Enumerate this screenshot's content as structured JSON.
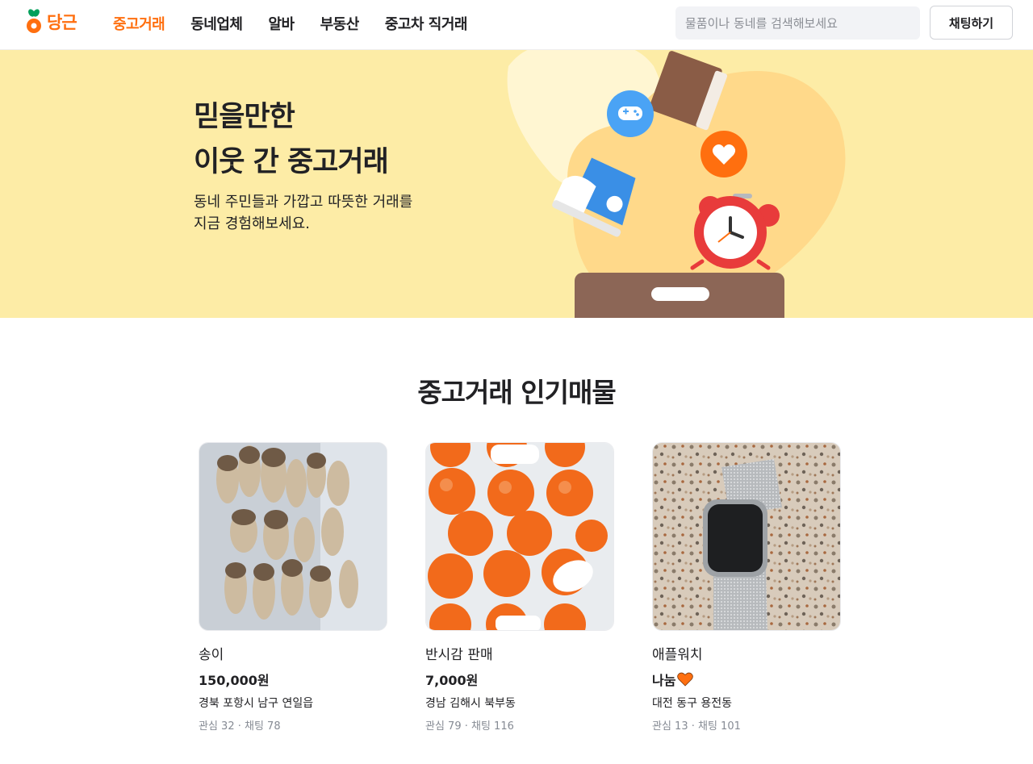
{
  "header": {
    "logo_text": "당근",
    "nav": [
      "중고거래",
      "동네업체",
      "알바",
      "부동산",
      "중고차 직거래"
    ],
    "search_placeholder": "물품이나 동네를 검색해보세요",
    "chat_button": "채팅하기"
  },
  "hero": {
    "title_line1": "믿을만한",
    "title_line2": "이웃 간 중고거래",
    "desc_line1": "동네 주민들과 가깝고 따뜻한 거래를",
    "desc_line2": "지금 경험해보세요."
  },
  "section": {
    "title": "중고거래 인기매물"
  },
  "products": [
    {
      "title": "송이",
      "price": "150,000원",
      "location": "경북 포항시 남구 연일읍",
      "counts": "관심 32 · 채팅 78"
    },
    {
      "title": "반시감 판매",
      "price": "7,000원",
      "location": "경남 김해시 북부동",
      "counts": "관심 79 · 채팅 116"
    },
    {
      "title": "애플워치",
      "price": "나눔",
      "location": "대전 동구 용전동",
      "counts": "관심 13 · 채팅 101"
    }
  ],
  "colors": {
    "brand": "#ff6f0f",
    "hero_bg": "#fdeca6"
  }
}
